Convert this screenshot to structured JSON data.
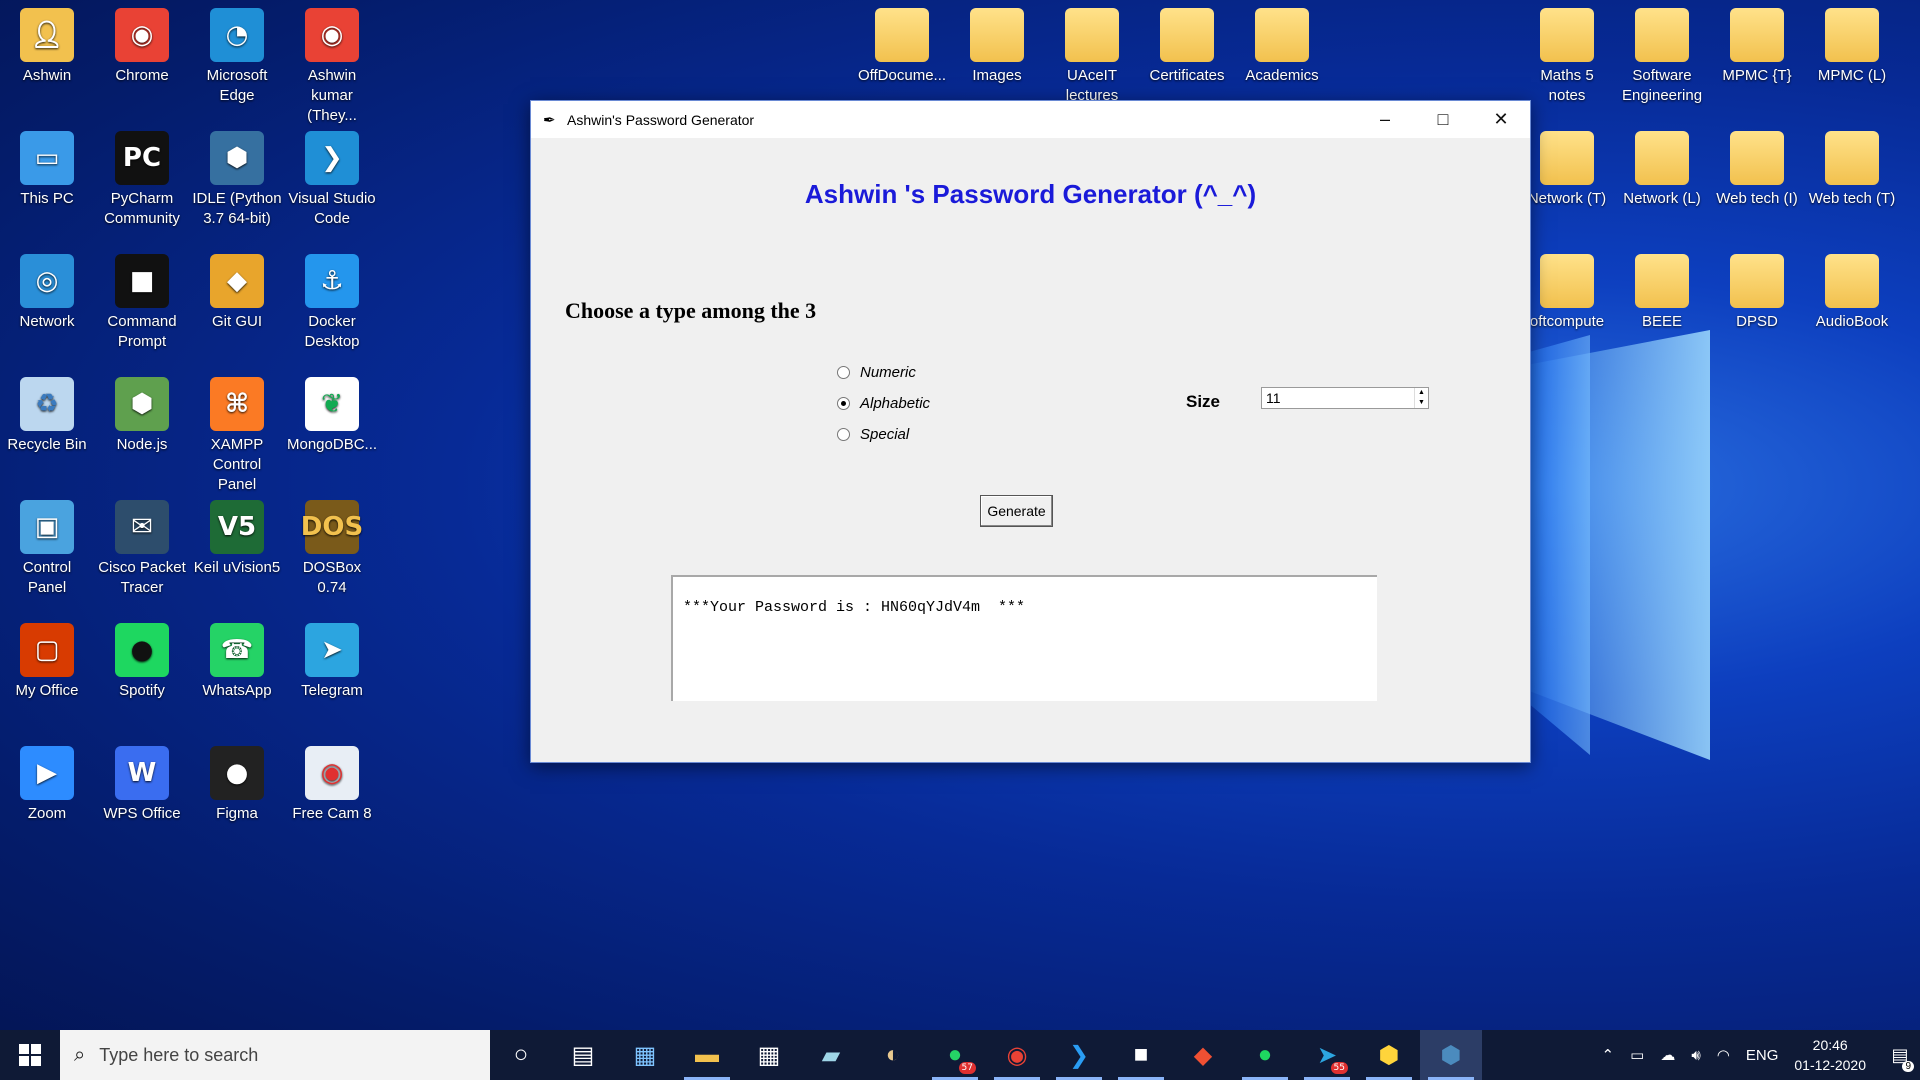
{
  "desktop": {
    "icons": [
      {
        "label": "Ashwin",
        "icon": "user-folder-icon"
      },
      {
        "label": "Chrome",
        "icon": "chrome-icon"
      },
      {
        "label": "Microsoft Edge",
        "icon": "edge-icon"
      },
      {
        "label": "Ashwin kumar (They...",
        "icon": "chrome-profile-icon"
      },
      {
        "label": "This PC",
        "icon": "computer-icon"
      },
      {
        "label": "PyCharm Community",
        "icon": "pycharm-icon"
      },
      {
        "label": "IDLE (Python 3.7 64-bit)",
        "icon": "python-idle-icon"
      },
      {
        "label": "Visual Studio Code",
        "icon": "vscode-icon"
      },
      {
        "label": "Network",
        "icon": "network-icon"
      },
      {
        "label": "Command Prompt",
        "icon": "cmd-icon"
      },
      {
        "label": "Git GUI",
        "icon": "git-icon"
      },
      {
        "label": "Docker Desktop",
        "icon": "docker-icon"
      },
      {
        "label": "Recycle Bin",
        "icon": "recycle-bin-icon"
      },
      {
        "label": "Node.js",
        "icon": "nodejs-icon"
      },
      {
        "label": "XAMPP Control Panel",
        "icon": "xampp-icon"
      },
      {
        "label": "MongoDBC...",
        "icon": "mongodb-icon"
      },
      {
        "label": "Control Panel",
        "icon": "control-panel-icon"
      },
      {
        "label": "Cisco Packet Tracer",
        "icon": "packet-tracer-icon"
      },
      {
        "label": "Keil uVision5",
        "icon": "keil-icon"
      },
      {
        "label": "DOSBox 0.74",
        "icon": "dosbox-icon"
      },
      {
        "label": "My Office",
        "icon": "office-icon"
      },
      {
        "label": "Spotify",
        "icon": "spotify-icon"
      },
      {
        "label": "WhatsApp",
        "icon": "whatsapp-icon"
      },
      {
        "label": "Telegram",
        "icon": "telegram-icon"
      },
      {
        "label": "Zoom",
        "icon": "zoom-icon"
      },
      {
        "label": "WPS Office",
        "icon": "wps-icon"
      },
      {
        "label": "Figma",
        "icon": "figma-icon"
      },
      {
        "label": "Free Cam 8",
        "icon": "freecam-icon"
      }
    ],
    "top_folders": [
      {
        "label": "OffDocume..."
      },
      {
        "label": "Images"
      },
      {
        "label": "UAceIT lectures"
      },
      {
        "label": "Certificates"
      },
      {
        "label": "Academics"
      }
    ],
    "right_folders": [
      {
        "label": "Maths 5 notes"
      },
      {
        "label": "Software Engineering"
      },
      {
        "label": "MPMC {T}"
      },
      {
        "label": "MPMC (L)"
      },
      {
        "label": "Network (T)"
      },
      {
        "label": "Network (L)"
      },
      {
        "label": "Web tech (I)"
      },
      {
        "label": "Web tech (T)"
      },
      {
        "label": "oftcompute"
      },
      {
        "label": "BEEE"
      },
      {
        "label": "DPSD"
      },
      {
        "label": "AudioBook"
      }
    ]
  },
  "window": {
    "title": "Ashwin's  Password Generator",
    "heading": "Ashwin 's Password Generator (^_^)",
    "prompt": "Choose a type among the 3",
    "options": [
      {
        "label": "Numeric",
        "selected": false
      },
      {
        "label": "Alphabetic",
        "selected": true
      },
      {
        "label": "Special",
        "selected": false
      }
    ],
    "size_label": "Size",
    "size_value": "11",
    "generate_label": "Generate",
    "output": "***Your Password is : HN60qYJdV4m  ***"
  },
  "taskbar": {
    "search_placeholder": "Type here to search",
    "whatsapp_badge": "57",
    "telegram_badge": "55",
    "language": "ENG",
    "time": "20:46",
    "date": "01-12-2020",
    "notification_count": "9"
  },
  "colors": {
    "heading": "#1a1ad9",
    "taskbar": "#0f1a36"
  }
}
